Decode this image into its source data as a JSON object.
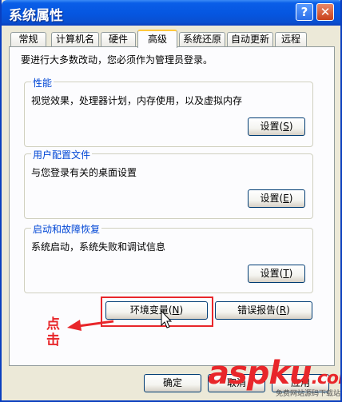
{
  "window": {
    "title": "系统属性",
    "help_glyph": "?",
    "close_glyph": "✕"
  },
  "tabs": [
    {
      "label": "常规",
      "active": false
    },
    {
      "label": "计算机名",
      "active": false
    },
    {
      "label": "硬件",
      "active": false
    },
    {
      "label": "高级",
      "active": true
    },
    {
      "label": "系统还原",
      "active": false
    },
    {
      "label": "自动更新",
      "active": false
    },
    {
      "label": "远程",
      "active": false
    }
  ],
  "panel": {
    "intro": "要进行大多数改动，您必须作为管理员登录。",
    "groups": [
      {
        "legend": "性能",
        "description": "视觉效果，处理器计划，内存使用，以及虚拟内存",
        "button_label": "设置",
        "mnemonic": "S"
      },
      {
        "legend": "用户配置文件",
        "description": "与您登录有关的桌面设置",
        "button_label": "设置",
        "mnemonic": "E"
      },
      {
        "legend": "启动和故障恢复",
        "description": "系统启动，系统失败和调试信息",
        "button_label": "设置",
        "mnemonic": "T"
      }
    ],
    "env_button": {
      "label": "环境变量",
      "mnemonic": "N"
    },
    "error_button": {
      "label": "错误报告",
      "mnemonic": "R"
    }
  },
  "footer": {
    "ok_label": "确定",
    "cancel_label": "取消",
    "apply_label": "应用"
  },
  "annotation": {
    "callout": "点击",
    "color": "#e8262a"
  },
  "watermark": {
    "brand": "aspku",
    "tld": ".com",
    "tagline": "免费网站源码下载站"
  },
  "colors": {
    "title_bar": "#0556e0",
    "panel_bg": "#fcfcfe",
    "dialog_bg": "#ece9d8",
    "legend_text": "#0046d5",
    "tab_accent": "#ffc83c"
  }
}
